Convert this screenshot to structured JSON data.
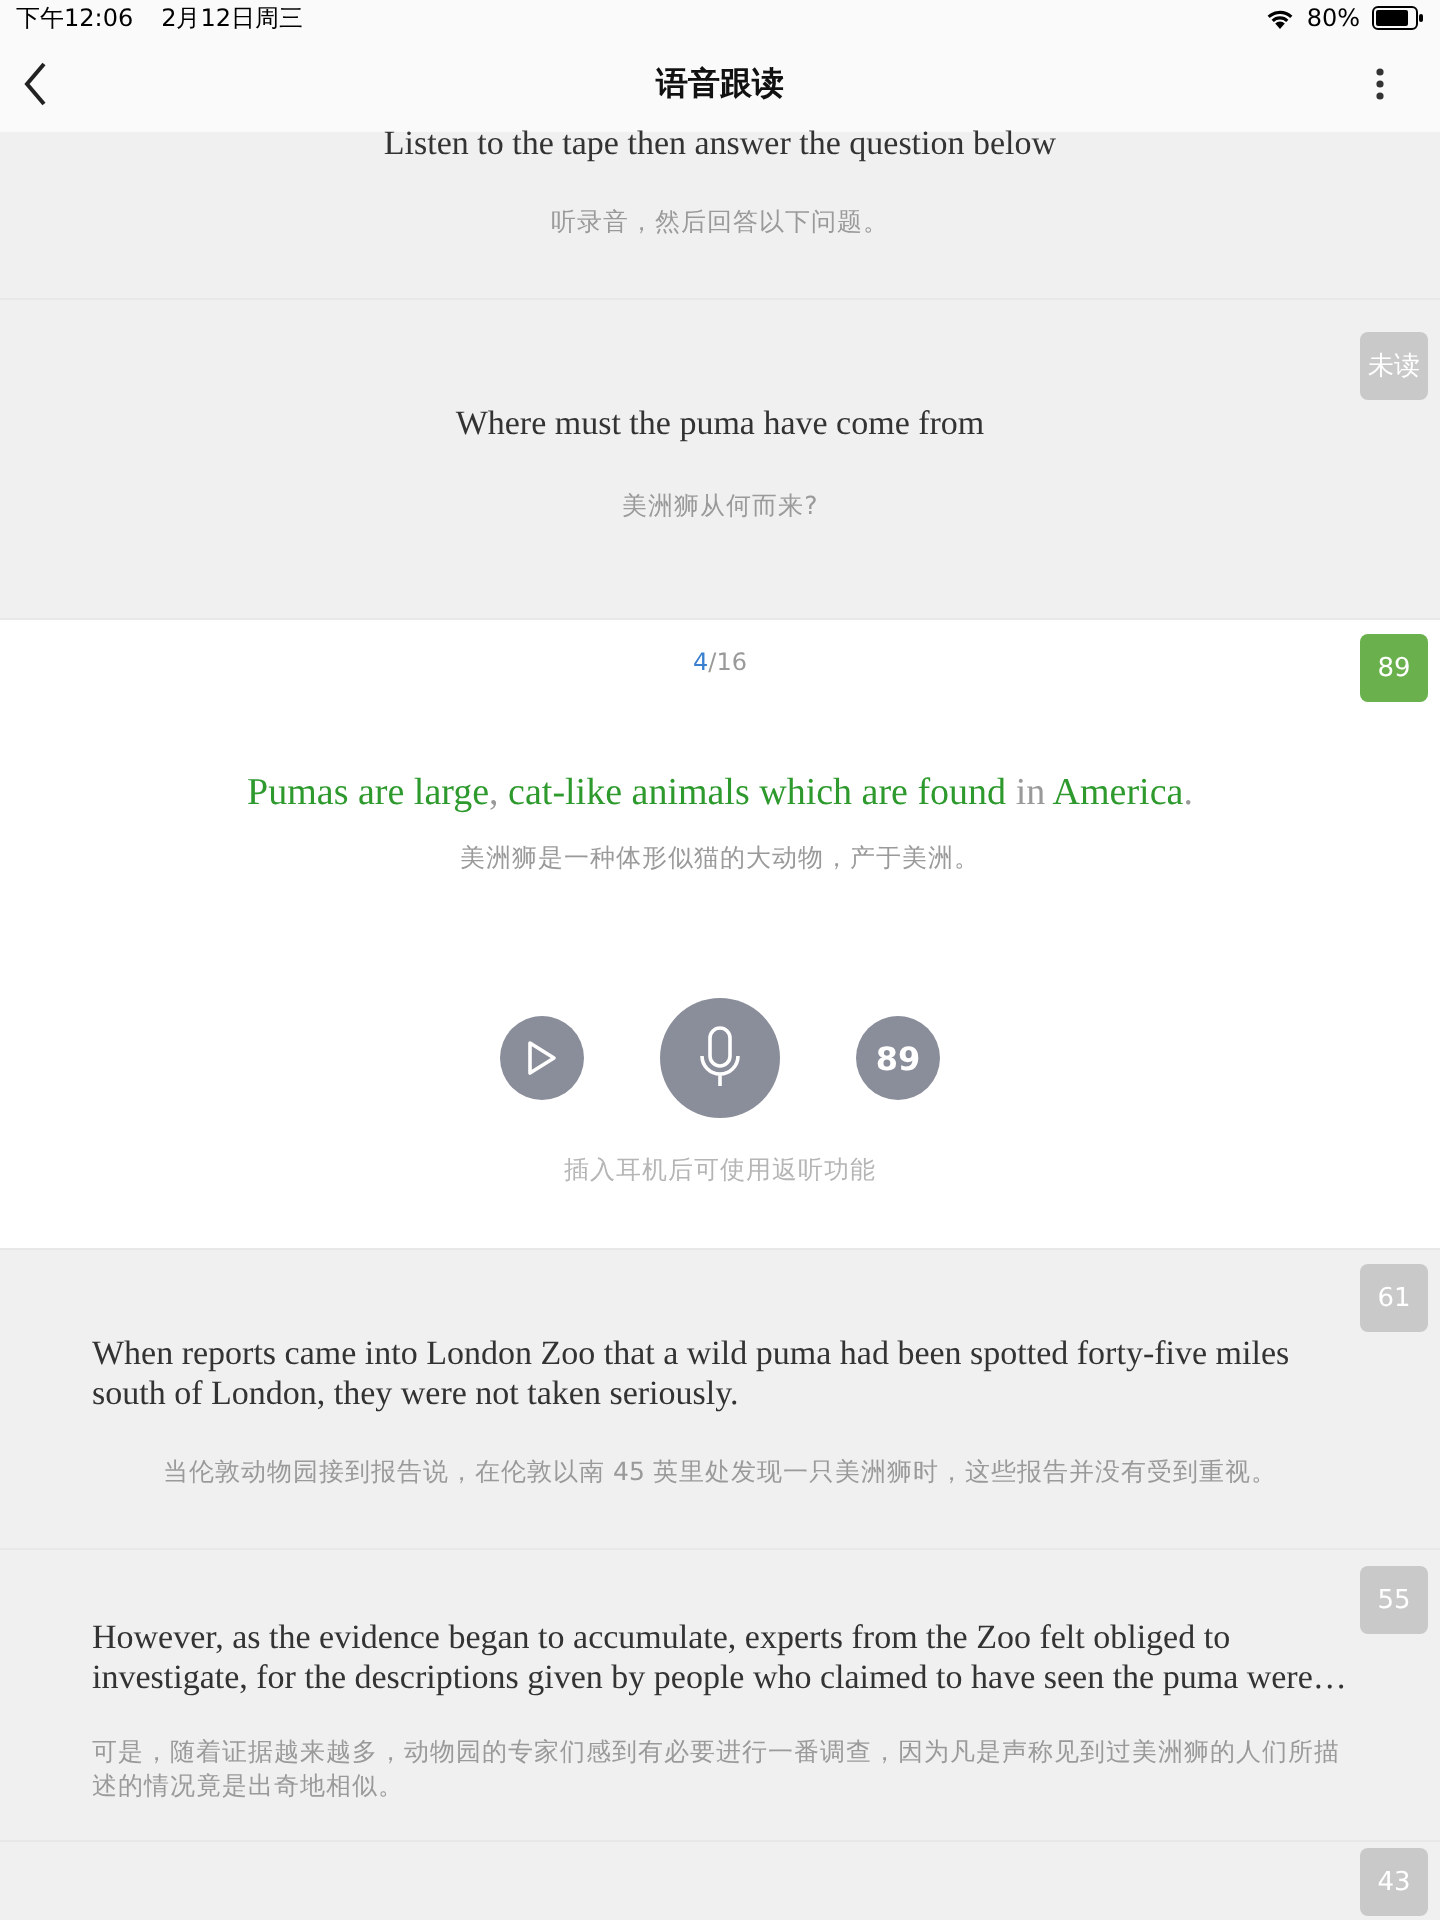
{
  "status_bar": {
    "time": "下午12:06",
    "date": "2月12日周三",
    "battery": "80%"
  },
  "nav": {
    "title": "语音跟读"
  },
  "items": [
    {
      "kind": "plain",
      "text": "Listen to the tape then answer the question below",
      "translation": "听录音，然后回答以下问题。"
    },
    {
      "kind": "plain",
      "badge": "未读",
      "text": "Where must the puma have come from",
      "translation": "美洲狮从何而来?"
    },
    {
      "kind": "active",
      "badge": "89",
      "selected": true,
      "counter": {
        "current": "4",
        "total": "/16"
      },
      "words": [
        {
          "text": "Pumas are large",
          "correct": true
        },
        {
          "text": ",",
          "correct": false
        },
        {
          "text": " cat-like animals which are found",
          "correct": true
        },
        {
          "text": " in",
          "correct": false
        },
        {
          "text": " America",
          "correct": true
        },
        {
          "text": ".",
          "correct": false
        }
      ],
      "translation": "美洲狮是一种体形似猫的大动物，产于美洲。",
      "score": "89",
      "hint": "插入耳机后可使用返听功能"
    },
    {
      "kind": "plain",
      "badge": "61",
      "selected": false,
      "text": "When reports came into London Zoo that a wild puma had been spotted forty-five miles south of London, they were not taken seriously.",
      "translation": "当伦敦动物园接到报告说，在伦敦以南 45 英里处发现一只美洲狮时，这些报告并没有受到重视。"
    },
    {
      "kind": "plain",
      "badge": "55",
      "selected": false,
      "text": "However, as the evidence began to accumulate, experts from the Zoo felt obliged to investigate, for the descriptions given by people who claimed to have seen the puma were…",
      "translation": "可是，随着证据越来越多，动物园的专家们感到有必要进行一番调查，因为凡是声称见到过美洲狮的人们所描述的情况竟是出奇地相似。"
    },
    {
      "kind": "stub",
      "badge": "43",
      "selected": false
    }
  ]
}
